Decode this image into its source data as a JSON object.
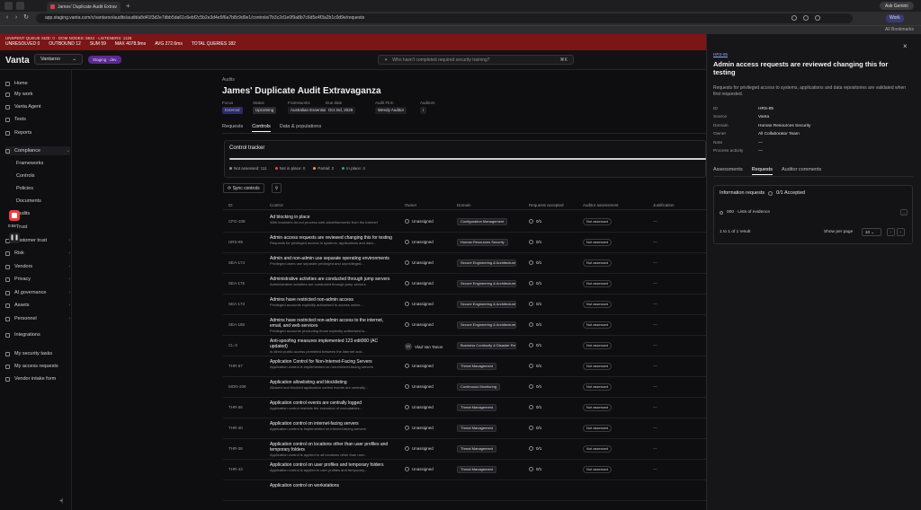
{
  "browser": {
    "tab_title": "James' Duplicate Audit Extrav...",
    "new_tab": "+",
    "profile": "Ask Gemini",
    "url": "app.staging.vanta.com/c/vantaroo/audits/audit/a8d41f3d2e7dbb5da61c6ebf2c5b2e3d4e5f6a7b8c9d0e1/controls/7b3c2d1e0f9a8b7c6d5e4f3a2b1c0d9e/requests",
    "bookmarks_label": "All Bookmarks",
    "profile_short": "Work"
  },
  "debug": {
    "line1": "UNSPENT QUEUE SIZE: 0 · DOM NODES: 5842 · LISTENERS: 1128",
    "metrics": [
      "UNRESOLVED 0",
      "OUTBOUND 12",
      "SUM 59",
      "MAX 4078.9ms",
      "AVG 272.6ms",
      "TOTAL QUERIES 182"
    ]
  },
  "topbar": {
    "logo": "Vanta",
    "org": "Vantaroo",
    "env_badge": "Staging · dev",
    "search_placeholder": "Who hasn't completed required security training?",
    "search_kbd": "⌘K"
  },
  "sidebar": {
    "items": [
      {
        "label": "Home",
        "icon": "home-icon"
      },
      {
        "label": "My work",
        "icon": "inbox-icon"
      },
      {
        "label": "Vanta Agent",
        "icon": "sparkle-icon"
      },
      {
        "label": "Tests",
        "icon": "check-icon"
      },
      {
        "label": "Reports",
        "icon": "chart-icon"
      },
      {
        "label": "Compliance",
        "icon": "shield-icon"
      },
      {
        "label": "Frameworks",
        "icon": ""
      },
      {
        "label": "Controls",
        "icon": ""
      },
      {
        "label": "Policies",
        "icon": ""
      },
      {
        "label": "Documents",
        "icon": ""
      },
      {
        "label": "Audits",
        "icon": ""
      },
      {
        "label": "Trust",
        "icon": ""
      },
      {
        "label": "Customer trust",
        "icon": "users-icon"
      },
      {
        "label": "Risk",
        "icon": "alert-icon"
      },
      {
        "label": "Vendors",
        "icon": "building-icon"
      },
      {
        "label": "Privacy",
        "icon": "lock-icon"
      },
      {
        "label": "AI governance",
        "icon": "bot-icon"
      },
      {
        "label": "Assets",
        "icon": "box-icon"
      },
      {
        "label": "Personnel",
        "icon": "person-icon"
      },
      {
        "label": "Integrations",
        "icon": "plug-icon"
      },
      {
        "label": "My security tasks",
        "icon": "task-icon"
      },
      {
        "label": "My access requests",
        "icon": "key-icon"
      },
      {
        "label": "Vendor intake form",
        "icon": "form-icon"
      }
    ],
    "recording_time": "0:58"
  },
  "audit": {
    "crumb": "Audits",
    "title": "James' Duplicate Audit Extravaganza",
    "meta": [
      {
        "key": "Focus",
        "value": "External"
      },
      {
        "key": "Status",
        "value": "Upcoming"
      },
      {
        "key": "Frameworks",
        "value": "Australian Essential 8"
      },
      {
        "key": "Due date",
        "value": "Oct 3rd, 2026"
      },
      {
        "key": "Audit Firm",
        "value": "Wendy Auditor"
      },
      {
        "key": "Auditors",
        "value": "i"
      }
    ],
    "tabs": [
      "Requests",
      "Controls",
      "Data & populations"
    ],
    "active_tab": "Controls"
  },
  "tracker": {
    "title": "Control tracker",
    "legend": [
      {
        "label": "Not assessed: 111",
        "color": "#8a8a90"
      },
      {
        "label": "Not in place: 0",
        "color": "#e5484d"
      },
      {
        "label": "Partial: 2",
        "color": "#f5a524"
      },
      {
        "label": "In place: 4",
        "color": "#30a46c"
      }
    ]
  },
  "toolbar": {
    "sync": "Sync controls",
    "filter_icon": "filter-icon"
  },
  "table": {
    "headers": [
      "ID",
      "Control",
      "Owner",
      "Domain",
      "Requests accepted",
      "Auditor assessment",
      "Justification"
    ],
    "rows": [
      {
        "id": "CFG-108",
        "title": "Ad blocking in place",
        "desc": "Web browsers do not process web advertisements from the internet",
        "owner": "Unassigned",
        "domain": "Configuration Management",
        "req": "0/1",
        "aa": "Not assessed",
        "just": "—"
      },
      {
        "id": "HRS-85",
        "title": "Admin access requests are reviewed changing this for testing",
        "desc": "Requests for privileged access to systems, applications and data...",
        "owner": "Unassigned",
        "domain": "Human Resources Security",
        "req": "0/1",
        "aa": "Not assessed",
        "just": "—"
      },
      {
        "id": "SEA-174",
        "title": "Admin and non-admin use separate operating environments",
        "desc": "Privileged users use separate privileged and unprivileged...",
        "owner": "Unassigned",
        "domain": "Secure Engineering & Architecture",
        "req": "0/1",
        "aa": "Not assessed",
        "just": "—"
      },
      {
        "id": "SEA-176",
        "title": "Administrative activities are conducted through jump servers",
        "desc": "Administrative activities are conducted through jump servers",
        "owner": "Unassigned",
        "domain": "Secure Engineering & Architecture",
        "req": "0/1",
        "aa": "Not assessed",
        "just": "—"
      },
      {
        "id": "SEA-173",
        "title": "Admins have restricted non-admin access",
        "desc": "Privileged accounts explicitly authorised to access online...",
        "owner": "Unassigned",
        "domain": "Secure Engineering & Architecture",
        "req": "0/1",
        "aa": "Not assessed",
        "just": "—"
      },
      {
        "id": "SEA-185",
        "title": "Admins have restricted non-admin access to the internet, email, and web services",
        "desc": "Privileged accounts (excluding those explicitly authorised to...",
        "owner": "Unassigned",
        "domain": "Secure Engineering & Architecture",
        "req": "0/1",
        "aa": "Not assessed",
        "just": "—"
      },
      {
        "id": "CL-3",
        "title": "Anti-spoofing measures implemented 123 edit000 (AC updated)",
        "desc": "Is direct public access permitted between the internet and...",
        "owner": "Vlad Van Tanon",
        "domain": "Business Continuity & Disaster Recovery",
        "req": "0/1",
        "aa": "Not assessed",
        "just": "—"
      },
      {
        "id": "THR-57",
        "title": "Application Control for Non-Internet-Facing Servers",
        "desc": "Application control is implemented on non-internet-facing servers",
        "owner": "Unassigned",
        "domain": "Threat Management",
        "req": "0/1",
        "aa": "Not assessed",
        "just": "—"
      },
      {
        "id": "MON-208",
        "title": "Application allowlisting and blocklisting",
        "desc": "Allowed and blocked application control events are centrally...",
        "owner": "Unassigned",
        "domain": "Continuous Monitoring",
        "req": "0/1",
        "aa": "Not assessed",
        "just": "—"
      },
      {
        "id": "THR-56",
        "title": "Application control events are centrally logged",
        "desc": "Application control restricts the execution of executables...",
        "owner": "Unassigned",
        "domain": "Threat Management",
        "req": "0/1",
        "aa": "Not assessed",
        "just": "—"
      },
      {
        "id": "THR-40",
        "title": "Application control on internet-facing servers",
        "desc": "Application control is implemented on internet-facing servers",
        "owner": "Unassigned",
        "domain": "Threat Management",
        "req": "0/1",
        "aa": "Not assessed",
        "just": "—"
      },
      {
        "id": "THR-38",
        "title": "Application control on locations other than user profiles and temporary folders",
        "desc": "Application control is applied to all locations other than user...",
        "owner": "Unassigned",
        "domain": "Threat Management",
        "req": "0/1",
        "aa": "Not assessed",
        "just": "—"
      },
      {
        "id": "THR-43",
        "title": "Application control on user profiles and temporary folders",
        "desc": "Application control is applied to user profiles and temporary...",
        "owner": "Unassigned",
        "domain": "Threat Management",
        "req": "0/1",
        "aa": "Not assessed",
        "just": "—"
      },
      {
        "id": "",
        "title": "Application control on workstations",
        "desc": "",
        "owner": "",
        "domain": "",
        "req": "",
        "aa": "",
        "just": ""
      }
    ]
  },
  "panel": {
    "id": "HRS-85",
    "title": "Admin access requests are reviewed changing this for testing",
    "desc": "Requests for privileged access to systems, applications and data repositories are validated when first requested.",
    "props": [
      {
        "k": "ID",
        "v": "HRS-85"
      },
      {
        "k": "Source",
        "v": "Vanta"
      },
      {
        "k": "Domain",
        "v": "Human Resources Security"
      },
      {
        "k": "Owner",
        "v": "All Collaborator Team"
      },
      {
        "k": "Note",
        "v": "—"
      },
      {
        "k": "Process activity",
        "v": "—"
      }
    ],
    "tabs": [
      "Assessments",
      "Requests",
      "Auditor comments"
    ],
    "active_tab": "Requests",
    "ir_title": "Information requests",
    "ir_count": "0/1 Accepted",
    "ir_item": "000 · Lists of evidence",
    "ir_more": "...",
    "results": "1 to 1 of 1 result",
    "per_page_label": "Show per page",
    "per_page": "10",
    "prev": "‹",
    "next": "›"
  }
}
